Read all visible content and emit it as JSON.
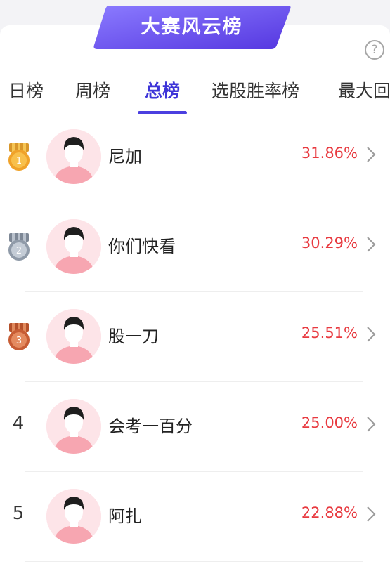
{
  "banner": {
    "title": "大赛风云榜",
    "color_start": "#7b6bff",
    "color_end": "#5a3fe0"
  },
  "help": {
    "icon": "question-circle-icon",
    "glyph": "?"
  },
  "tabs": [
    {
      "label": "日榜",
      "active": false
    },
    {
      "label": "周榜",
      "active": false
    },
    {
      "label": "总榜",
      "active": true
    },
    {
      "label": "选股胜率榜",
      "active": false
    },
    {
      "label": "最大回",
      "active": false
    }
  ],
  "accent_color": "#4b3fe0",
  "rate_color": "#e8393f",
  "ranking": [
    {
      "rank": "1",
      "medal": "gold",
      "name": "尼加",
      "rate": "31.86%"
    },
    {
      "rank": "2",
      "medal": "silver",
      "name": "你们快看",
      "rate": "30.29%"
    },
    {
      "rank": "3",
      "medal": "bronze",
      "name": "股一刀",
      "rate": "25.51%"
    },
    {
      "rank": "4",
      "medal": null,
      "name": "会考一百分",
      "rate": "25.00%"
    },
    {
      "rank": "5",
      "medal": null,
      "name": "阿扎",
      "rate": "22.88%"
    }
  ]
}
